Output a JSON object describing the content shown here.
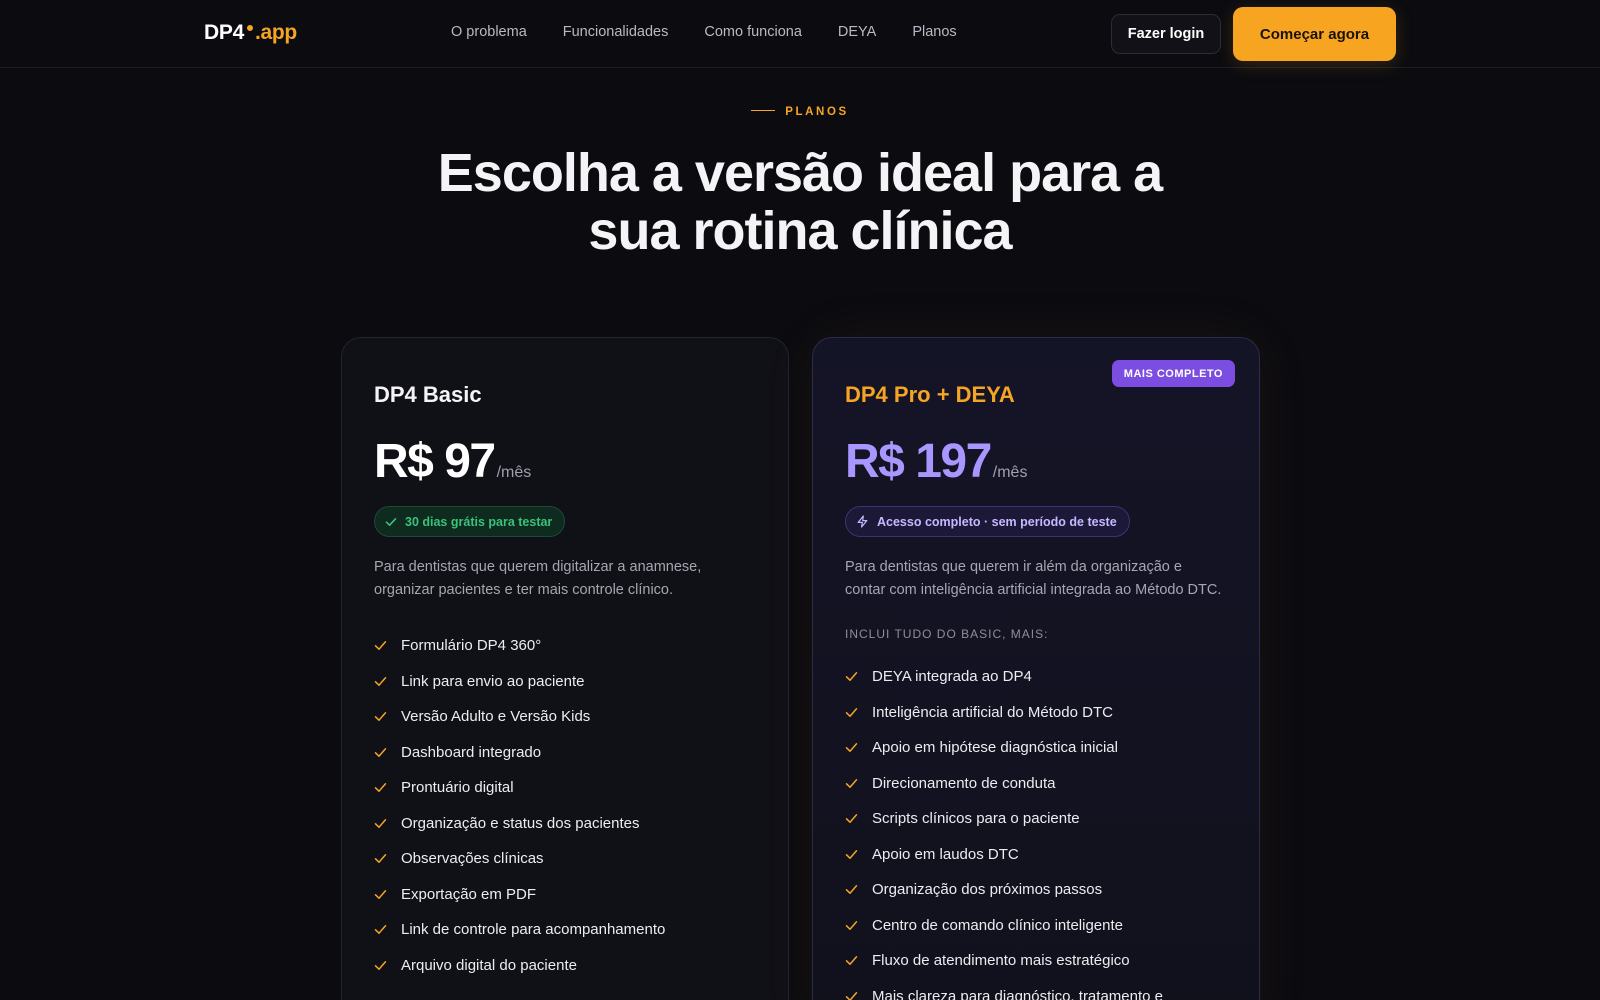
{
  "header": {
    "logo_brand": "DP4",
    "logo_tld": ".app",
    "nav": [
      "O problema",
      "Funcionalidades",
      "Como funciona",
      "DEYA",
      "Planos"
    ],
    "login_label": "Fazer login",
    "cta_label": "Começar agora"
  },
  "section": {
    "eyebrow": "PLANOS",
    "title_line1": "Escolha a versão ideal para a",
    "title_line2": "sua rotina clínica"
  },
  "plans": [
    {
      "name": "DP4 Basic",
      "price": "R$ 97",
      "period": "/mês",
      "pill": "30 dias grátis para testar",
      "pill_icon": "check-icon",
      "description": "Para dentistas que querem digitalizar a anamnese, organizar pacientes e ter mais controle clínico.",
      "features": [
        "Formulário DP4 360°",
        "Link para envio ao paciente",
        "Versão Adulto e Versão Kids",
        "Dashboard integrado",
        "Prontuário digital",
        "Organização e status dos pacientes",
        "Observações clínicas",
        "Exportação em PDF",
        "Link de controle para acompanhamento",
        "Arquivo digital do paciente"
      ]
    },
    {
      "name": "DP4 Pro + DEYA",
      "badge": "MAIS COMPLETO",
      "price": "R$ 197",
      "period": "/mês",
      "pill": "Acesso completo · sem período de teste",
      "pill_icon": "lightning-icon",
      "description": "Para dentistas que querem ir além da organização e contar com inteligência artificial integrada ao Método DTC.",
      "includes_label": "INCLUI TUDO DO BASIC, MAIS:",
      "features": [
        "DEYA integrada ao DP4",
        "Inteligência artificial do Método DTC",
        "Apoio em hipótese diagnóstica inicial",
        "Direcionamento de conduta",
        "Scripts clínicos para o paciente",
        "Apoio em laudos DTC",
        "Organização dos próximos passos",
        "Centro de comando clínico inteligente",
        "Fluxo de atendimento mais estratégico",
        "Mais clareza para diagnóstico, tratamento e"
      ]
    }
  ],
  "colors": {
    "accent": "#f5a524",
    "purple": "#a996ff",
    "badge": "#7b4de0",
    "background": "#0b0b10"
  }
}
